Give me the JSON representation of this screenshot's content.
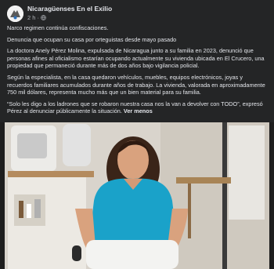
{
  "post": {
    "page_name": "Nicaragüenses En el Exilio",
    "time": "2 h",
    "paragraphs": [
      "Narco regimen continúa confiscaciones.",
      "Denuncia que ocupan su casa por orteguistas desde mayo pasado",
      "La doctora Anely Pérez Molina, expulsada de Nicaragua junto a su familia en 2023, denunció que personas afines al oficialismo estarían ocupando actualmente su vivienda ubicada en El Crucero, una propiedad que permaneció durante más de dos años bajo vigilancia policial.",
      "Según la especialista, en la casa quedaron vehículos, muebles, equipos electrónicos, joyas y recuerdos familiares acumulados durante años de trabajo. La vivienda, valorada en aproximadamente 750 mil dólares, representa mucho más que un bien material para su familia."
    ],
    "last_paragraph": "“Solo les digo a los ladrones que se robaron nuestra casa nos la van a devolver con TODO”, expresó Pérez al denunciar públicamente la situación.",
    "see_more": "Ver menos"
  },
  "icons": {
    "avatar": "page-logo",
    "privacy": "globe-icon",
    "menu": "more-options-icon"
  }
}
